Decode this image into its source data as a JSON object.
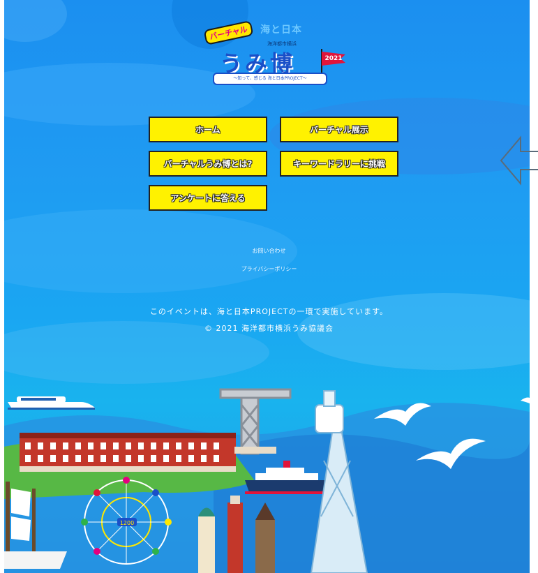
{
  "logo": {
    "badge": "バーチャル",
    "top_text": "海と日本",
    "subtitle": "海洋都市横浜",
    "title": "うみ博",
    "ribbon": "〜知って、感じる 海と日本PROJECT〜",
    "year": "2021"
  },
  "nav": [
    {
      "label": "ホーム"
    },
    {
      "label": "バーチャル展示"
    },
    {
      "label": "バーチャルうみ博とは?"
    },
    {
      "label": "キーワードラリーに挑戦"
    },
    {
      "label": "アンケートに答える"
    }
  ],
  "footer": {
    "contact": "お問い合わせ",
    "privacy": "プライバシーポリシー",
    "note": "このイベントは、海と日本PROJECTの一環で実施しています。",
    "copyright": "© 2021 海洋都市横浜うみ協議会"
  },
  "scene": {
    "ferris_wheel_label": "1200"
  },
  "colors": {
    "sea": "#1b8ff0",
    "button": "#fff200",
    "flag": "#e2143a"
  }
}
